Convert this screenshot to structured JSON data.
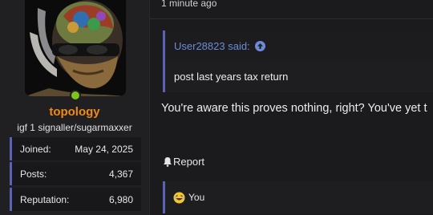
{
  "user": {
    "name": "topology",
    "title": "igf 1 signaller/sugarmaxxer",
    "stats": [
      {
        "label": "Joined:",
        "value": "May 24, 2025"
      },
      {
        "label": "Posts:",
        "value": "4,367"
      },
      {
        "label": "Reputation:",
        "value": "6,980"
      }
    ],
    "online_color": "#7dc41e",
    "name_color": "#f08a16"
  },
  "post": {
    "timestamp": "1 minute ago",
    "quote": {
      "author": "User28823 said:",
      "body": "post last years tax return"
    },
    "text": "You're aware this proves nothing, right? You've yet t",
    "report_label": "Report",
    "reactions_label": "You"
  },
  "theme": {
    "accent": "#5c62b5",
    "link": "#6b8bd6",
    "background": "#1b1b1d"
  }
}
